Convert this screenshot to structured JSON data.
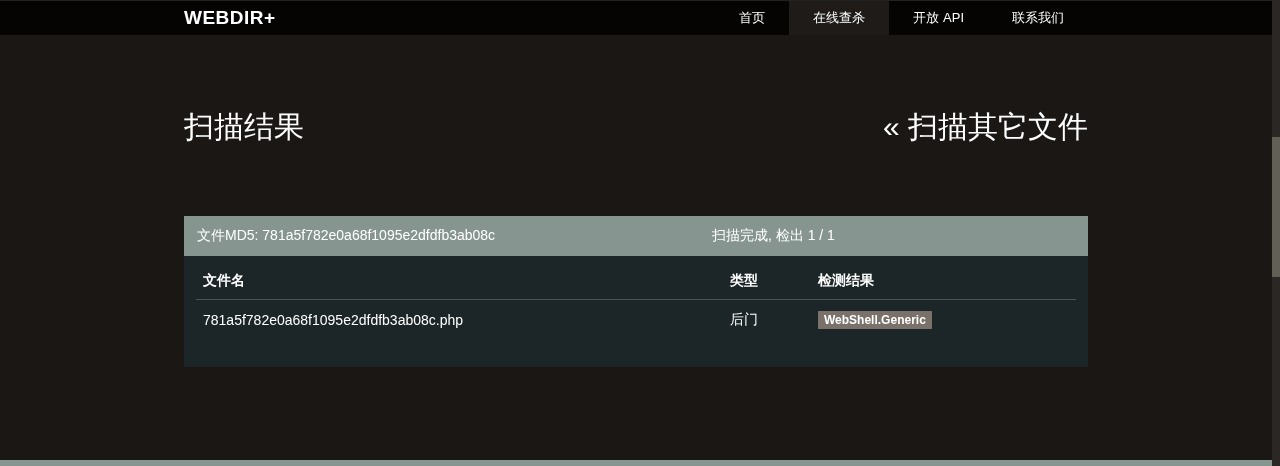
{
  "brand": "WEBDIR+",
  "nav": [
    {
      "label": "首页",
      "selected": false
    },
    {
      "label": "在线查杀",
      "selected": true
    },
    {
      "label": "开放 API",
      "selected": false
    },
    {
      "label": "联系我们",
      "selected": false
    }
  ],
  "page_title": "扫描结果",
  "back_link": "« 扫描其它文件",
  "result": {
    "md5": "文件MD5: 781a5f782e0a68f1095e2dfdfb3ab08c",
    "status": "扫描完成, 检出 1 / 1",
    "columns": [
      "文件名",
      "类型",
      "检测结果"
    ],
    "rows": [
      {
        "file": "781a5f782e0a68f1095e2dfdfb3ab08c.php",
        "type": "后门",
        "detection": "WebShell.Generic"
      }
    ]
  }
}
